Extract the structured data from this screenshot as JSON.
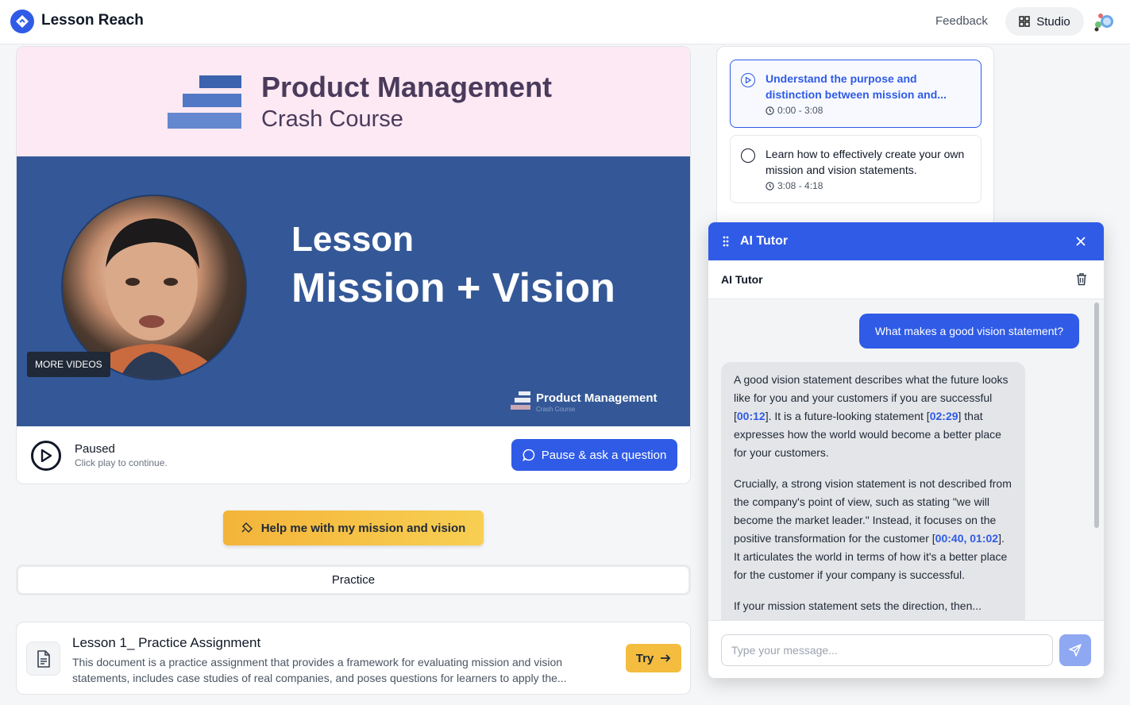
{
  "header": {
    "app_name": "Lesson Reach",
    "feedback_label": "Feedback",
    "studio_label": "Studio"
  },
  "video": {
    "banner_title": "Product Management",
    "banner_subtitle": "Crash Course",
    "lesson_word": "Lesson",
    "lesson_name": "Mission + Vision",
    "more_videos_label": "MORE VIDEOS",
    "mini_logo_title": "Product Management",
    "mini_logo_subtitle": "Crash Course",
    "status": "Paused",
    "status_hint": "Click play to continue.",
    "ask_label": "Pause & ask a question"
  },
  "help_label": "Help me with my mission and vision",
  "practice_tab_label": "Practice",
  "assignment": {
    "title": "Lesson 1_ Practice Assignment",
    "description": "This document is a practice assignment that provides a framework for evaluating mission and vision statements, includes case studies of real companies, and poses questions for learners to apply the...",
    "try_label": "Try"
  },
  "chapters": [
    {
      "title": "Understand the purpose and distinction between mission and...",
      "time": "0:00 - 3:08",
      "active": true
    },
    {
      "title": "Learn how to effectively create your own mission and vision statements.",
      "time": "3:08 - 4:18",
      "active": false
    }
  ],
  "tutor": {
    "title": "AI Tutor",
    "subtitle": "AI Tutor",
    "user_message": "What makes a good vision statement?",
    "reply": {
      "p1a": "A good vision statement describes what the future looks like for you and your customers if you are successful [",
      "ts1": "00:12",
      "p1b": "]. It is a future-looking statement [",
      "ts2": "02:29",
      "p1c": "] that expresses how the world would become a better place for your customers.",
      "p2a": "Crucially, a strong vision statement is not described from the company's point of view, such as stating \"we will become the market leader.\" Instead, it focuses on the positive transformation for the customer [",
      "ts3": "00:40",
      "p2b": ", ",
      "ts4": "01:02",
      "p2c": "]. It articulates the world in terms of how it's a better place for the customer if your company is successful.",
      "p3": "If your mission statement sets the direction, then..."
    },
    "input_placeholder": "Type your message..."
  },
  "colors": {
    "brand_blue": "#2f5be6",
    "banner_blue": "#345897",
    "banner_pink": "#fde9f3",
    "accent_yellow": "#f4bd3f"
  }
}
